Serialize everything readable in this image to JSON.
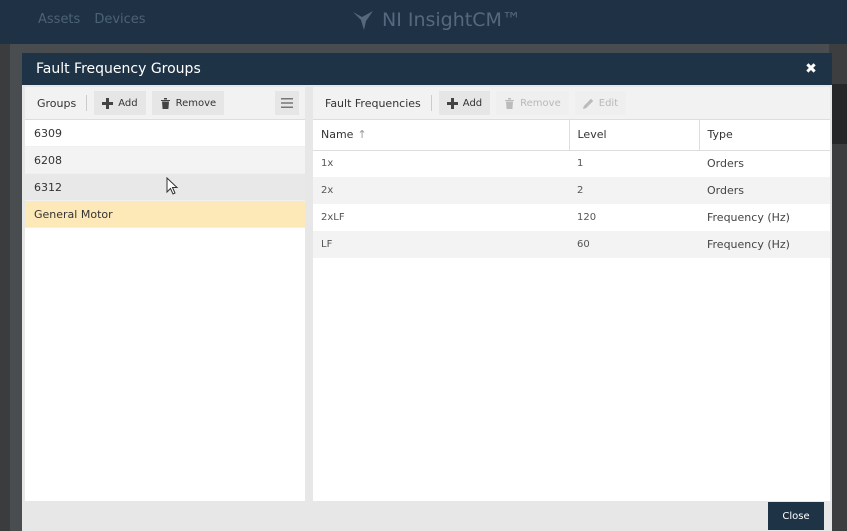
{
  "background": {
    "nav": [
      "Assets",
      "Devices"
    ],
    "brand": "NI InsightCM™"
  },
  "modal": {
    "title": "Fault Frequency Groups",
    "close_label": "Close"
  },
  "groups_toolbar": {
    "label": "Groups",
    "add_label": "Add",
    "remove_label": "Remove"
  },
  "groups": [
    {
      "name": "6309"
    },
    {
      "name": "6208"
    },
    {
      "name": "6312"
    },
    {
      "name": "General Motor"
    }
  ],
  "frequencies_toolbar": {
    "label": "Fault Frequencies",
    "add_label": "Add",
    "remove_label": "Remove",
    "edit_label": "Edit"
  },
  "table": {
    "columns": [
      "Name",
      "Level",
      "Type"
    ],
    "sort_indicator": "↑",
    "rows": [
      {
        "name": "1x",
        "level": "1",
        "type": "Orders"
      },
      {
        "name": "2x",
        "level": "2",
        "type": "Orders"
      },
      {
        "name": "2xLF",
        "level": "120",
        "type": "Frequency (Hz)"
      },
      {
        "name": "LF",
        "level": "60",
        "type": "Frequency (Hz)"
      }
    ]
  },
  "colors": {
    "header_bg": "#1f3346",
    "selected_row": "#fde9b8"
  }
}
